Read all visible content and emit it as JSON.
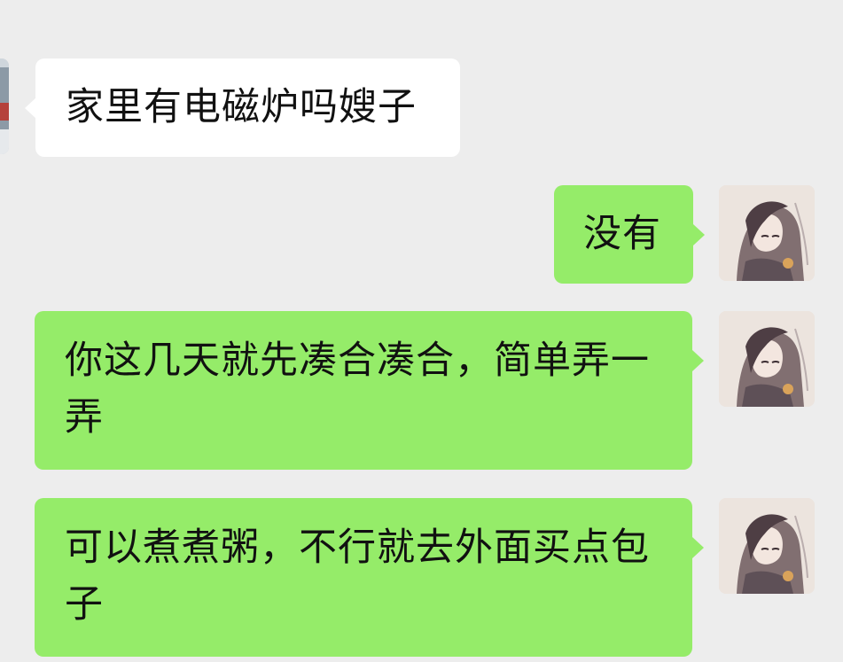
{
  "chat": {
    "messages": [
      {
        "direction": "incoming",
        "text": "家里有电磁炉吗嫂子"
      },
      {
        "direction": "outgoing",
        "text": "没有"
      },
      {
        "direction": "outgoing",
        "text": "你这几天就先凑合凑合，简单弄一弄"
      },
      {
        "direction": "outgoing",
        "text": "可以煮煮粥，不行就去外面买点包子"
      }
    ],
    "avatars": {
      "contact_icon": "contact-avatar-icon",
      "self_icon": "anime-girl-avatar-icon"
    }
  },
  "colors": {
    "background": "#ededed",
    "incoming_bubble": "#ffffff",
    "outgoing_bubble": "#95ec69",
    "text": "#111111"
  }
}
